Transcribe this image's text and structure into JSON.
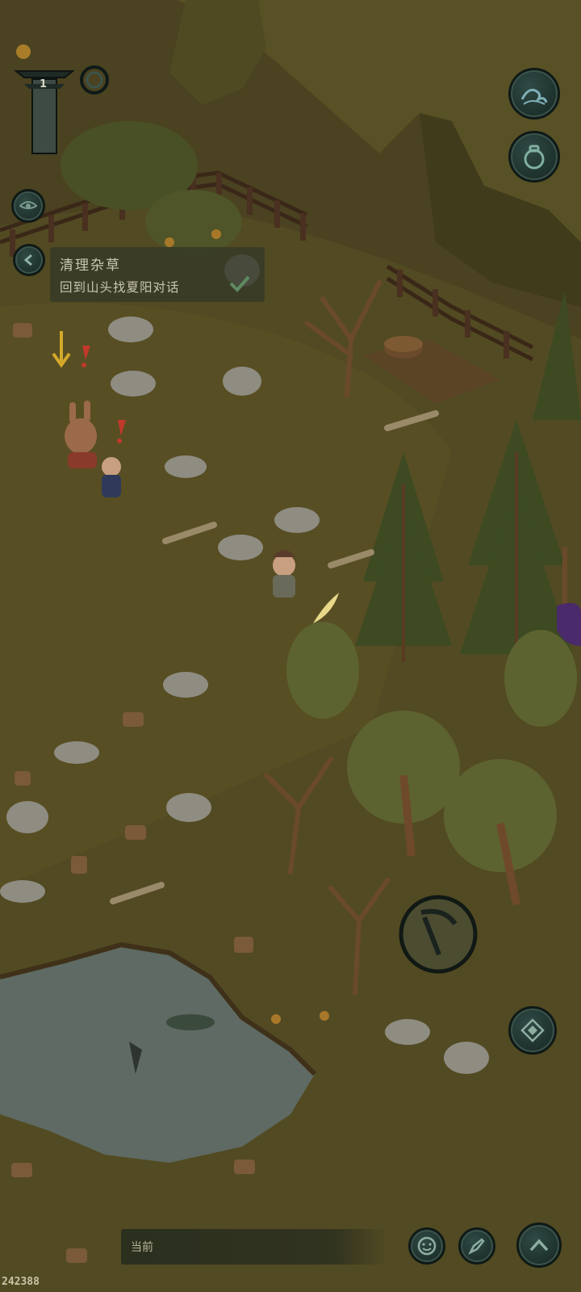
{
  "quest": {
    "title": "清理杂草",
    "subtitle": "回到山头找夏阳对话"
  },
  "hud": {
    "level": "1",
    "chat_label": "当前",
    "uid": "242388"
  },
  "colors": {
    "overlay_tint": "#3e3718",
    "button_dark": "#1d302c",
    "button_rim": "#3c544c",
    "alert_red": "#c0392b",
    "arrow_yellow": "#d4a92a"
  },
  "icons": {
    "top_right_1": "wave-icon",
    "top_right_2": "bag-icon",
    "left_small": "eye-icon",
    "quest_back": "chevron-left-icon",
    "quest_done": "checkmark-icon",
    "action": "sickle-icon",
    "secondary_action": "compass-icon",
    "bottom_1": "emoji-icon",
    "bottom_2": "pen-icon",
    "bottom_3": "chevron-up-icon"
  }
}
